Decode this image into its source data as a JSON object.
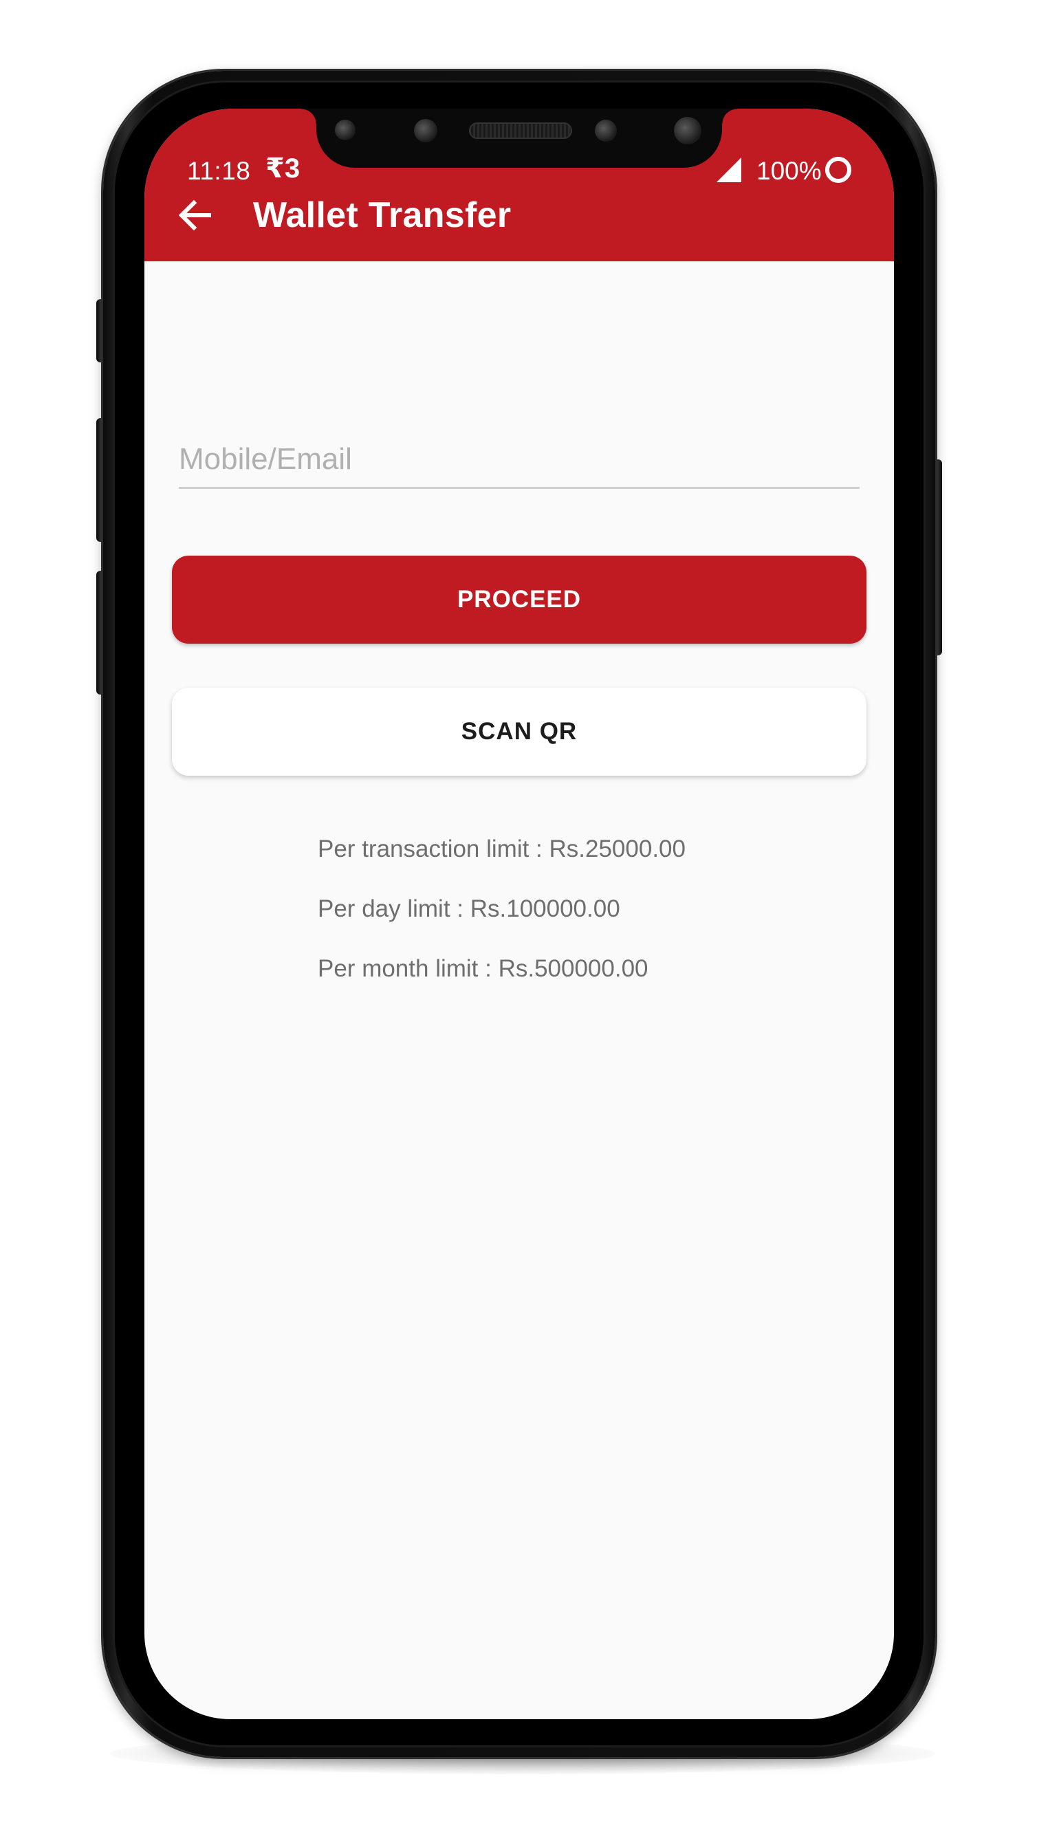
{
  "status_bar": {
    "time": "11:18",
    "rupee_glyph": "₹3",
    "battery_text": "100%",
    "icons": [
      "signal-icon",
      "battery-icon"
    ]
  },
  "app_bar": {
    "title": "Wallet Transfer",
    "back_icon": "arrow-left-icon",
    "color": "#c01b22"
  },
  "form": {
    "mobile_email_placeholder": "Mobile/Email",
    "mobile_email_value": ""
  },
  "buttons": {
    "proceed_label": "PROCEED",
    "scan_qr_label": "SCAN QR"
  },
  "limits": {
    "per_transaction": "Per transaction limit : Rs.25000.00",
    "per_day": "Per day limit : Rs.100000.00",
    "per_month": "Per month limit : Rs.500000.00"
  },
  "colors": {
    "primary": "#c01b22",
    "background": "#fafafa",
    "limit_text": "#6e6e6e"
  }
}
